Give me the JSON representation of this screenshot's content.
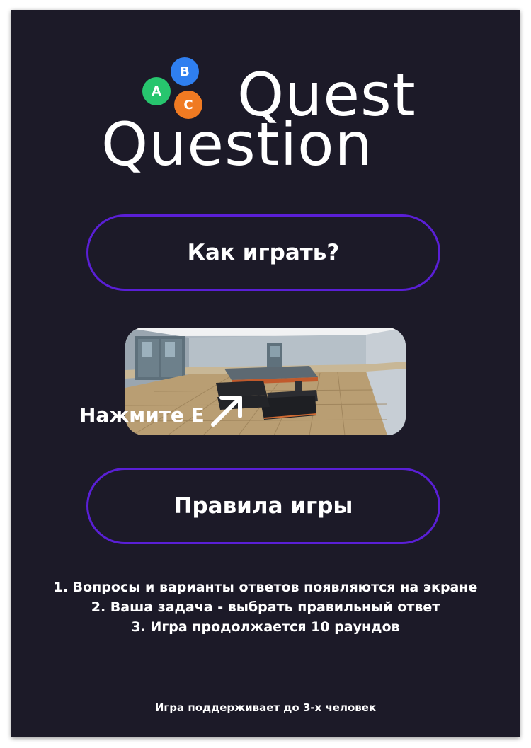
{
  "logo": {
    "letters": [
      {
        "char": "A",
        "color": "#27c56e"
      },
      {
        "char": "B",
        "color": "#2f7ff0"
      },
      {
        "char": "C",
        "color": "#f07a22"
      }
    ],
    "title_line1": "Quest",
    "title_line2": "Question"
  },
  "buttons": {
    "how_to_play": "Как играть?",
    "rules": "Правила игры"
  },
  "hint": {
    "text": "Нажмите E",
    "icon": "arrow-up-right-icon"
  },
  "rules": [
    "1. Вопросы и варианты ответов появляются на экране",
    "2. Ваша задача - выбрать правильный ответ",
    "3. Игра продолжается 10 раундов"
  ],
  "footer": "Игра поддерживает до 3-х человек",
  "colors": {
    "background": "#1c1a28",
    "button_border": "#5a1fd6",
    "text": "#ffffff"
  }
}
